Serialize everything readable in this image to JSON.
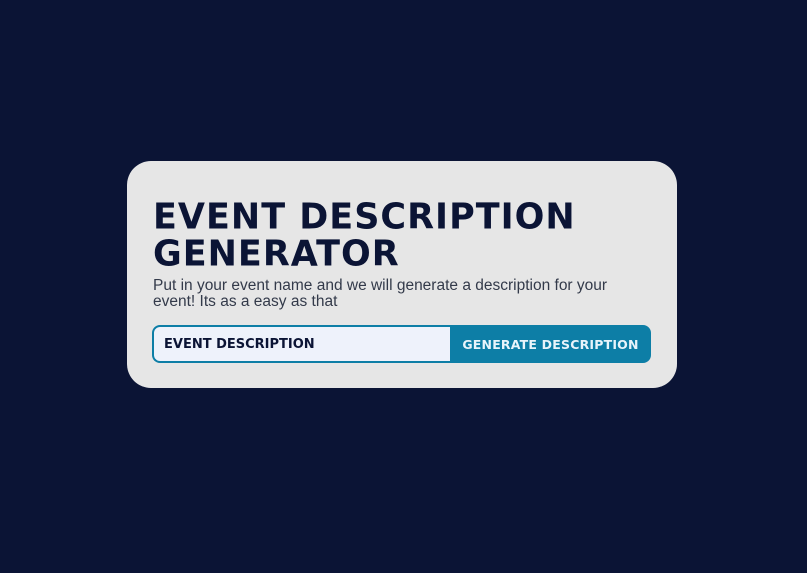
{
  "card": {
    "title_line1": "Event Description",
    "title_line2": "Generator",
    "subtitle": "Put in your event name and we will generate a description for your event! Its as a easy as that"
  },
  "form": {
    "input_placeholder": "Event description",
    "input_value": "",
    "button_label": "Generate Description"
  },
  "colors": {
    "page_background": "#0b1435",
    "card_background": "#e6e6e6",
    "title_color": "#0b1435",
    "accent": "#0d7ea6",
    "input_background": "#eef2fb"
  }
}
